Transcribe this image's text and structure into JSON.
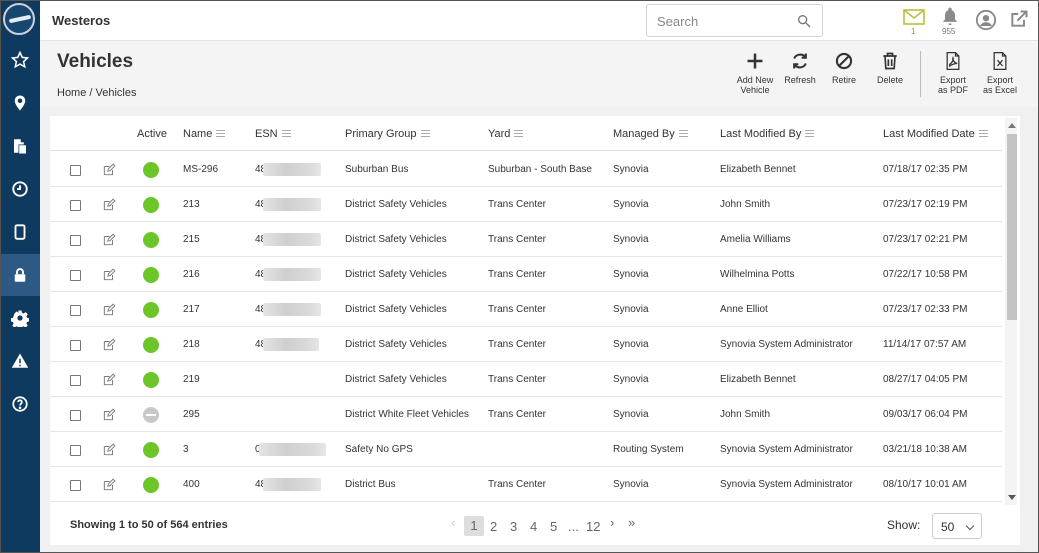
{
  "app": {
    "title": "Westeros"
  },
  "search": {
    "placeholder": "Search"
  },
  "topbar": {
    "mail_count": "1",
    "notification_count": "955"
  },
  "page": {
    "title": "Vehicles",
    "breadcrumb": "Home / Vehicles"
  },
  "actions": [
    {
      "label1": "Add New",
      "label2": "Vehicle",
      "icon": "plus-icon"
    },
    {
      "label1": "Refresh",
      "label2": "",
      "icon": "refresh-icon"
    },
    {
      "label1": "Retire",
      "label2": "",
      "icon": "ban-icon"
    },
    {
      "label1": "Delete",
      "label2": "",
      "icon": "trash-icon"
    },
    {
      "label1": "Export",
      "label2": "as PDF",
      "icon": "pdf-icon"
    },
    {
      "label1": "Export",
      "label2": "as Excel",
      "icon": "excel-icon"
    }
  ],
  "table": {
    "columns": [
      "Active",
      "Name",
      "ESN",
      "Primary Group",
      "Yard",
      "Managed By",
      "Last Modified By",
      "Last Modified Date"
    ],
    "rows": [
      {
        "active": true,
        "name": "MS-296",
        "esn": "48",
        "group": "Suburban Bus",
        "yard": "Suburban - South Base",
        "managed": "Synovia",
        "modby": "Elizabeth Bennet",
        "date": "07/18/17 02:35 PM"
      },
      {
        "active": true,
        "name": "213",
        "esn": "48",
        "group": "District Safety Vehicles",
        "yard": "Trans Center",
        "managed": "Synovia",
        "modby": "John Smith",
        "date": "07/23/17 02:19 PM"
      },
      {
        "active": true,
        "name": "215",
        "esn": "48",
        "group": "District Safety Vehicles",
        "yard": "Trans Center",
        "managed": "Synovia",
        "modby": "Amelia Williams",
        "date": "07/23/17 02:21 PM"
      },
      {
        "active": true,
        "name": "216",
        "esn": "48",
        "group": "District Safety Vehicles",
        "yard": "Trans Center",
        "managed": "Synovia",
        "modby": "Wilhelmina Potts",
        "date": "07/22/17 10:58 PM"
      },
      {
        "active": true,
        "name": "217",
        "esn": "48",
        "group": "District Safety Vehicles",
        "yard": "Trans Center",
        "managed": "Synovia",
        "modby": "Anne Elliot",
        "date": "07/23/17 02:33 PM"
      },
      {
        "active": true,
        "name": "218",
        "esn": "48",
        "group": "District Safety Vehicles",
        "yard": "Trans Center",
        "managed": "Synovia",
        "modby": "Synovia System Administrator",
        "date": "11/14/17 07:57 AM"
      },
      {
        "active": true,
        "name": "219",
        "esn": "",
        "group": "District Safety Vehicles",
        "yard": "Trans Center",
        "managed": "Synovia",
        "modby": "Elizabeth Bennet",
        "date": "08/27/17 04:05 PM"
      },
      {
        "active": false,
        "name": "295",
        "esn": "",
        "group": "District White Fleet Vehicles",
        "yard": "Trans Center",
        "managed": "Synovia",
        "modby": "John Smith",
        "date": "09/03/17 06:04 PM"
      },
      {
        "active": true,
        "name": "3",
        "esn": "0",
        "group": "Safety No GPS",
        "yard": "",
        "managed": "Routing System",
        "modby": "Synovia System Administrator",
        "date": "03/21/18 10:38 AM"
      },
      {
        "active": true,
        "name": "400",
        "esn": "48",
        "group": "District Bus",
        "yard": "Trans Center",
        "managed": "Synovia",
        "modby": "Synovia System Administrator",
        "date": "08/10/17 10:01 AM"
      }
    ]
  },
  "footer": {
    "info": "Showing 1 to 50 of 564 entries",
    "pages": [
      "1",
      "2",
      "3",
      "4",
      "5",
      "...",
      "12"
    ],
    "show_label": "Show:",
    "page_size": "50"
  },
  "colors": {
    "sidebar": "#0f3a5f",
    "active_green": "#6cc627",
    "inactive_gray": "#c8c8c8"
  }
}
